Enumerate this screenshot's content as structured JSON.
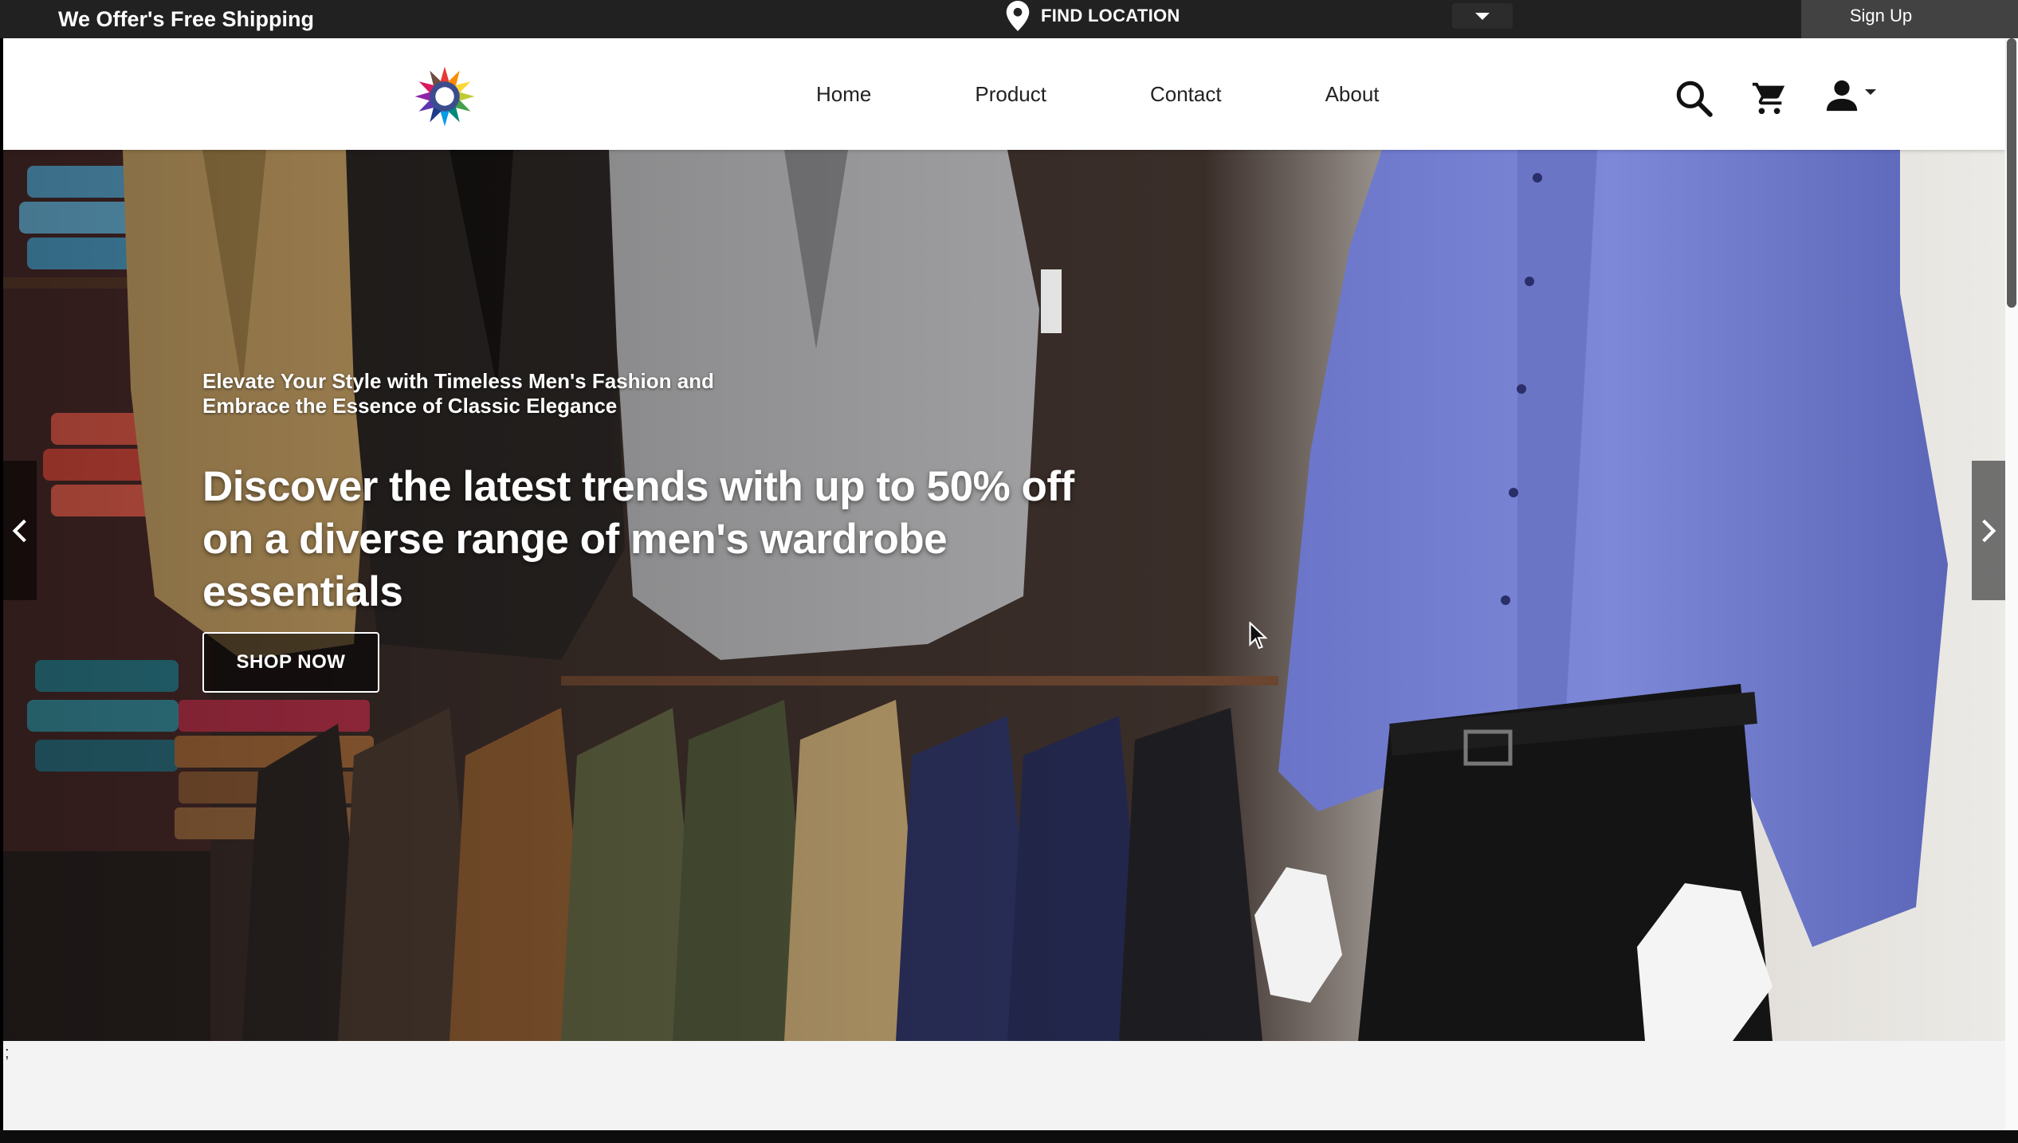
{
  "topbar": {
    "shipping_text": "We Offer's Free Shipping",
    "find_location_label": "FIND LOCATION",
    "signup_label": "Sign Up"
  },
  "nav": {
    "items": [
      {
        "label": "Home"
      },
      {
        "label": "Product"
      },
      {
        "label": "Contact"
      },
      {
        "label": "About"
      }
    ]
  },
  "hero": {
    "subtitle": "Elevate Your Style with Timeless Men's Fashion and Embrace the Essence of Classic Elegance",
    "title": "Discover the latest trends with up to 50% off on a diverse range of men's wardrobe essentials",
    "cta_label": "SHOP NOW"
  },
  "bottom": {
    "stray_mark": ";"
  },
  "icons": {
    "location": "map-pin-icon",
    "search": "search-icon",
    "cart": "cart-icon",
    "account": "user-icon",
    "prev": "chevron-left-icon",
    "next": "chevron-right-icon"
  },
  "colors": {
    "topbar_bg": "#212121",
    "signup_bg": "#424242",
    "header_bg": "#ffffff",
    "hero_text": "#ffffff"
  }
}
